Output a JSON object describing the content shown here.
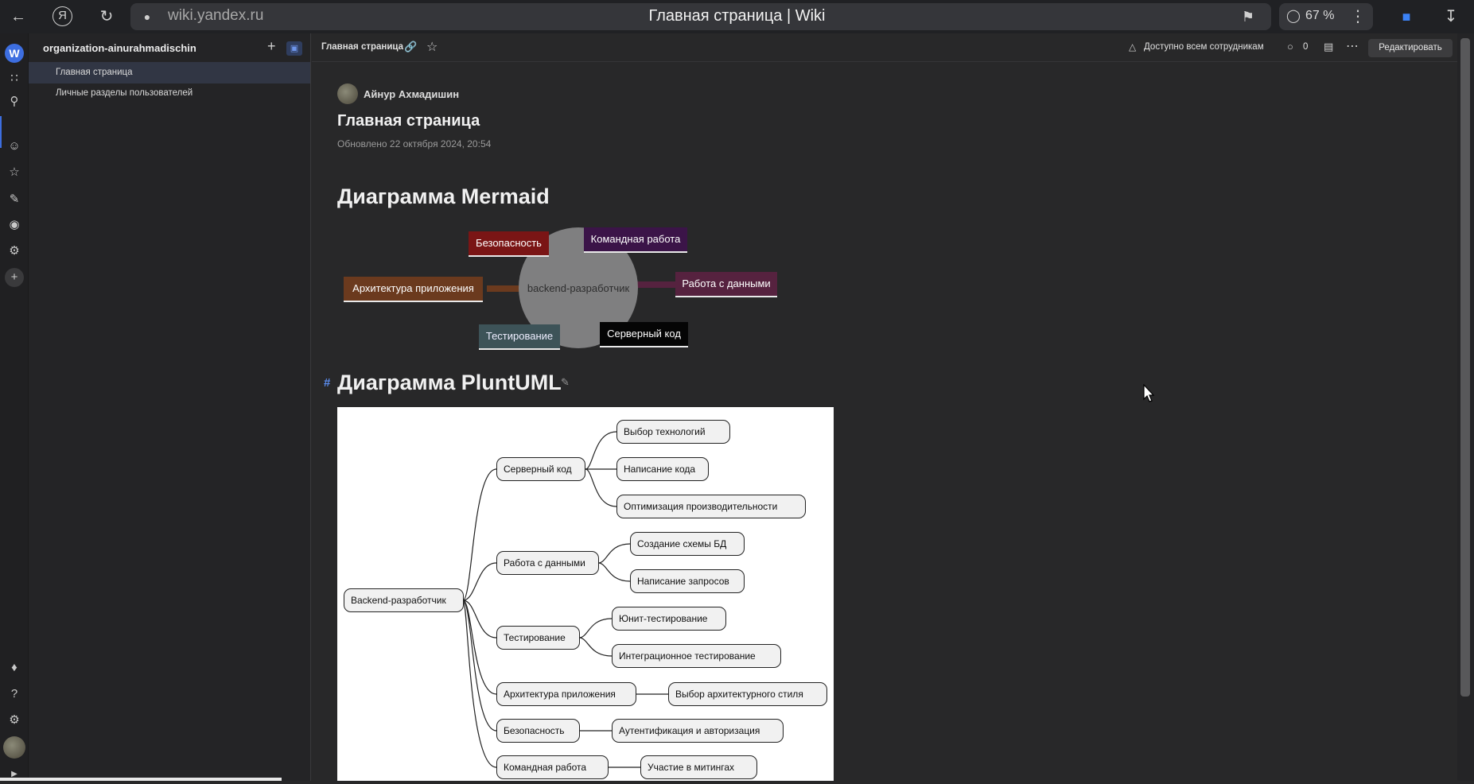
{
  "browser": {
    "url": "wiki.yandex.ru",
    "tab_title": "Главная страница | Wiki",
    "zoom": "67 %",
    "icons": [
      "back-arrow-icon",
      "yandex-logo-icon",
      "reload-icon",
      "lock-icon",
      "bookmark-icon",
      "comment-icon",
      "more-vertical-icon",
      "extension-icon",
      "download-icon"
    ]
  },
  "rail": {
    "workspace_letter": "W",
    "icons": [
      "apps-grid-icon",
      "search-icon",
      "user-icon",
      "star-icon",
      "user-edit-icon",
      "eye-icon",
      "user-settings-icon",
      "plus-icon",
      "bell-icon",
      "help-icon",
      "settings-icon",
      "avatar"
    ]
  },
  "sidebar": {
    "org_name": "organization-ainurahmadischin",
    "items": [
      {
        "label": "Главная страница",
        "active": true
      },
      {
        "label": "Личные разделы пользователей",
        "active": false
      }
    ]
  },
  "header": {
    "breadcrumb": "Главная страница",
    "access": "Доступно всем сотрудникам",
    "comments_count": "0",
    "edit_label": "Редактировать"
  },
  "article": {
    "author": "Айнур Ахмадишин",
    "title": "Главная страница",
    "updated": "Обновлено 22 октября 2024, 20:54",
    "h2_mermaid": "Диаграмма Mermaid",
    "h2_plantuml": "Диаграмма PluntUML",
    "anchor": "#"
  },
  "mermaid": {
    "center": "backend-разработчик",
    "nodes": {
      "security": "Безопасность",
      "teamwork": "Командная работа",
      "architecture": "Архитектура приложения",
      "data": "Работа с данными",
      "testing": "Тестирование",
      "server": "Серверный код"
    },
    "colors": {
      "security": "#7a1515",
      "teamwork": "#3b1448",
      "architecture": "#6b3a1e",
      "data": "#56223f",
      "testing": "#3d5358",
      "server": "#050505"
    }
  },
  "plantuml": {
    "root": "Backend-разработчик",
    "branches": {
      "server": "Серверный код",
      "data": "Работа с данными",
      "testing": "Тестирование",
      "architecture": "Архитектура приложения",
      "security": "Безопасность",
      "teamwork": "Командная работа"
    },
    "leaves": {
      "tech": "Выбор технологий",
      "coding": "Написание кода",
      "optimization": "Оптимизация производительности",
      "schema": "Создание схемы БД",
      "queries": "Написание запросов",
      "unit": "Юнит-тестирование",
      "integration": "Интеграционное тестирование",
      "style": "Выбор архитектурного стиля",
      "auth": "Аутентификация и авторизация",
      "meetings": "Участие в митингах"
    }
  }
}
